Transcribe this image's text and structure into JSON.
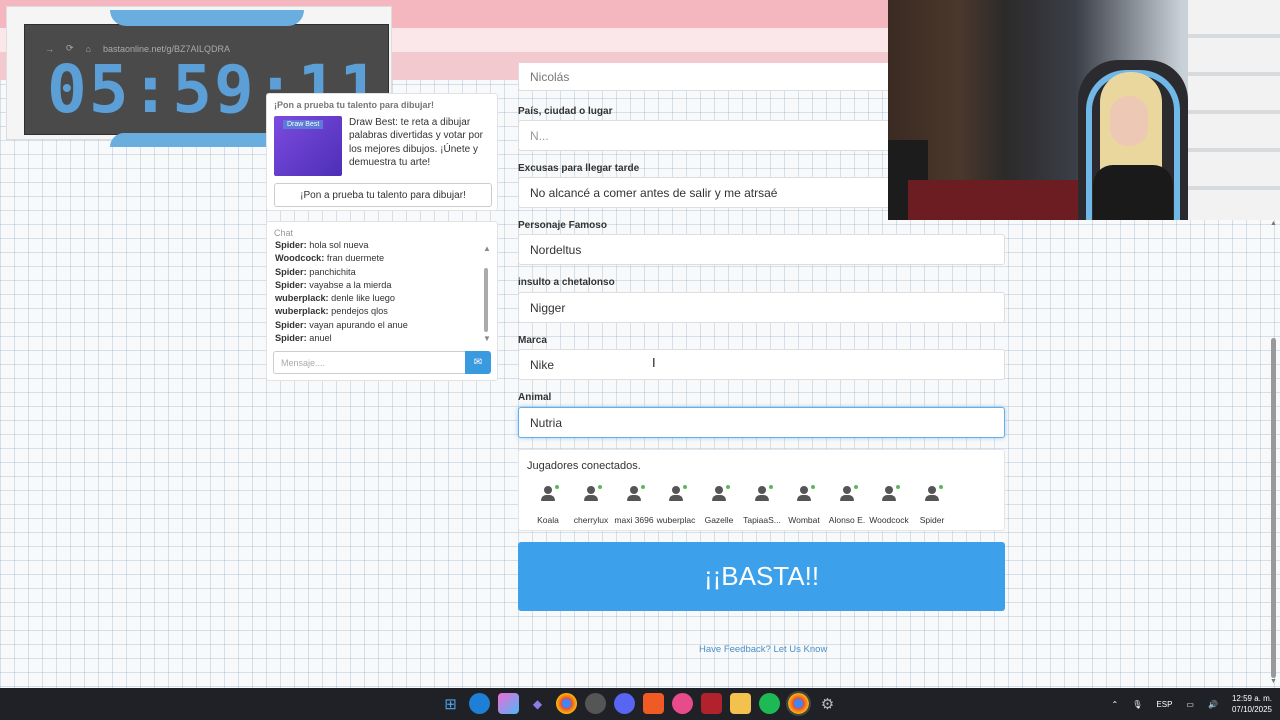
{
  "timer": {
    "url": "bastaonline.net/g/BZ7AILQDRA",
    "value": "05:59:11"
  },
  "promo": {
    "title": "¡Pon a prueba tu talento para dibujar!",
    "image_label": "Draw Best",
    "text": "Draw Best: te reta a dibujar palabras divertidas y votar por los mejores dibujos. ¡Únete y demuestra tu arte!",
    "button_label": "¡Pon a prueba tu talento para dibujar!"
  },
  "chat": {
    "title": "Chat",
    "messages": [
      {
        "user": "Spider:",
        "text": "hola sol nueva"
      },
      {
        "user": "Woodcock:",
        "text": "fran duermete"
      },
      {
        "user": "Spider:",
        "text": "panchichita"
      },
      {
        "user": "Spider:",
        "text": "vayabse a la mierda"
      },
      {
        "user": "wuberplack:",
        "text": "denle like luego"
      },
      {
        "user": "wuberplack:",
        "text": "pendejos qlos"
      },
      {
        "user": "Spider:",
        "text": "vayan apurando el anue"
      },
      {
        "user": "Spider:",
        "text": "anuel"
      }
    ],
    "input_placeholder": "Mensaje...."
  },
  "form": {
    "fields": [
      {
        "label": "",
        "value": "Nicolás",
        "placeholder": false,
        "focused": false
      },
      {
        "label": "País, ciudad o lugar",
        "value": "N...",
        "placeholder": true,
        "focused": false
      },
      {
        "label": "Excusas para llegar tarde",
        "value": "No alcancé a comer antes de salir y me atrsaé",
        "placeholder": false,
        "focused": false
      },
      {
        "label": "Personaje Famoso",
        "value": "Nordeltus",
        "placeholder": false,
        "focused": false
      },
      {
        "label": "insulto a chetalonso",
        "value": "Nigger",
        "placeholder": false,
        "focused": false
      },
      {
        "label": "Marca",
        "value": "Nike",
        "placeholder": false,
        "focused": false
      },
      {
        "label": "Animal",
        "value": "Nutria",
        "placeholder": false,
        "focused": true
      }
    ]
  },
  "players": {
    "title": "Jugadores conectados.",
    "list": [
      "Koala",
      "cherrylux",
      "maxi 3696",
      "wuberplac",
      "Gazelle",
      "TapiaaS...",
      "Wombat",
      "Alonso E.",
      "Woodcock",
      "Spider"
    ],
    "online_color": "#5cb85c"
  },
  "basta_button": "¡¡BASTA!!",
  "feedback_link": "Have Feedback? Let Us Know",
  "taskbar": {
    "icons": [
      "windows-start-icon",
      "edge-icon",
      "copilot-icon",
      "visual-studio-icon",
      "chrome-icon",
      "obs-icon",
      "discord-icon",
      "brave-icon",
      "app-icon",
      "game-icon",
      "file-explorer-icon",
      "spotify-icon",
      "chrome-active-icon",
      "settings-icon"
    ],
    "language": "ESP",
    "time": "12:59 a. m.",
    "date": "07/10/2025"
  },
  "colors": {
    "accent": "#3ca1ea",
    "timer": "#5b9fd6",
    "band": "#f4b6bf"
  }
}
